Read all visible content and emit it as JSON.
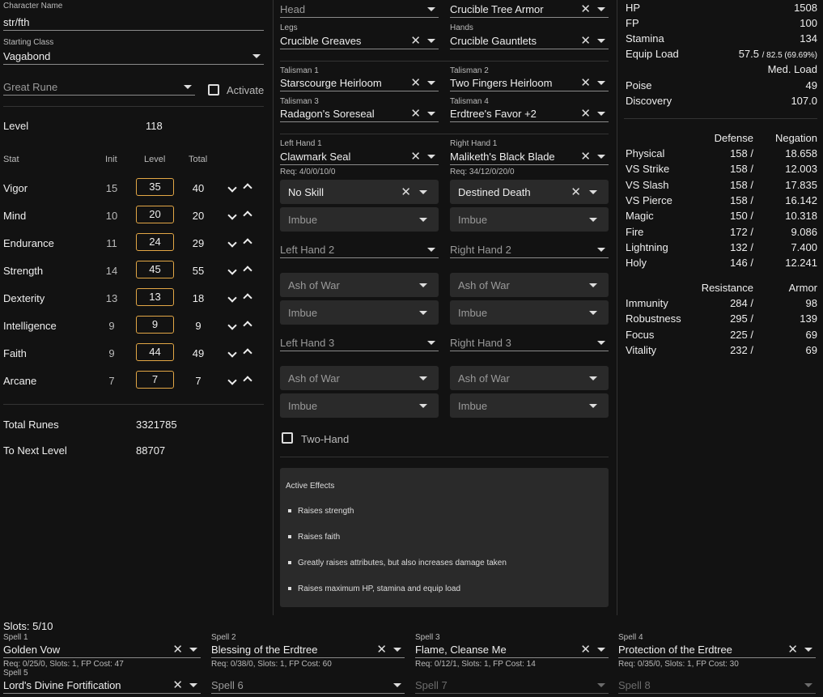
{
  "character": {
    "name_label": "Character Name",
    "name": "str/fth",
    "class_label": "Starting Class",
    "class": "Vagabond",
    "great_rune_placeholder": "Great Rune",
    "activate_label": "Activate"
  },
  "level": {
    "label": "Level",
    "value": "118"
  },
  "stat_headers": {
    "stat": "Stat",
    "init": "Init",
    "level": "Level",
    "total": "Total"
  },
  "stats": [
    {
      "name": "Vigor",
      "init": "15",
      "level": "35",
      "total": "40"
    },
    {
      "name": "Mind",
      "init": "10",
      "level": "20",
      "total": "20"
    },
    {
      "name": "Endurance",
      "init": "11",
      "level": "24",
      "total": "29"
    },
    {
      "name": "Strength",
      "init": "14",
      "level": "45",
      "total": "55"
    },
    {
      "name": "Dexterity",
      "init": "13",
      "level": "13",
      "total": "18"
    },
    {
      "name": "Intelligence",
      "init": "9",
      "level": "9",
      "total": "9"
    },
    {
      "name": "Faith",
      "init": "9",
      "level": "44",
      "total": "49"
    },
    {
      "name": "Arcane",
      "init": "7",
      "level": "7",
      "total": "7"
    }
  ],
  "runes": {
    "total_label": "Total Runes",
    "total": "3321785",
    "next_label": "To Next Level",
    "next": "88707"
  },
  "equipment": {
    "head_placeholder": "Head",
    "chest": "Crucible Tree Armor",
    "legs_label": "Legs",
    "legs": "Crucible Greaves",
    "hands_label": "Hands",
    "hands": "Crucible Gauntlets",
    "t1_label": "Talisman 1",
    "t1": "Starscourge Heirloom",
    "t2_label": "Talisman 2",
    "t2": "Two Fingers Heirloom",
    "t3_label": "Talisman 3",
    "t3": "Radagon's Soreseal",
    "t4_label": "Talisman 4",
    "t4": "Erdtree's Favor +2",
    "lh1_label": "Left Hand 1",
    "lh1": "Clawmark Seal",
    "lh1_req": "Req: 4/0/0/10/0",
    "rh1_label": "Right Hand 1",
    "rh1": "Maliketh's Black Blade",
    "rh1_req": "Req: 34/12/0/20/0",
    "lh1_skill": "No Skill",
    "rh1_skill": "Destined Death",
    "imbue": "Imbue",
    "ash": "Ash of War",
    "lh2": "Left Hand 2",
    "rh2": "Right Hand 2",
    "lh3": "Left Hand 3",
    "rh3": "Right Hand 3",
    "two_hand_label": "Two-Hand"
  },
  "effects": {
    "title": "Active Effects",
    "items": [
      "Raises strength",
      "Raises faith",
      "Greatly raises attributes, but also increases damage taken",
      "Raises maximum HP, stamina and equip load"
    ]
  },
  "stats_right": {
    "hp_label": "HP",
    "hp": "1508",
    "fp_label": "FP",
    "fp": "100",
    "stamina_label": "Stamina",
    "stamina": "134",
    "equip_label": "Equip Load",
    "equip": "57.5",
    "equip_detail": "/ 82.5 (69.69%)",
    "load_class": "Med. Load",
    "poise_label": "Poise",
    "poise": "49",
    "discovery_label": "Discovery",
    "discovery": "107.0"
  },
  "defense": {
    "h1": "Defense",
    "h2": "Negation",
    "rows": [
      {
        "name": "Physical",
        "def": "158 /",
        "neg": "18.658"
      },
      {
        "name": "VS Strike",
        "def": "158 /",
        "neg": "12.003"
      },
      {
        "name": "VS Slash",
        "def": "158 /",
        "neg": "17.835"
      },
      {
        "name": "VS Pierce",
        "def": "158 /",
        "neg": "16.142"
      },
      {
        "name": "Magic",
        "def": "150 /",
        "neg": "10.318"
      },
      {
        "name": "Fire",
        "def": "172 /",
        "neg": "9.086"
      },
      {
        "name": "Lightning",
        "def": "132 /",
        "neg": "7.400"
      },
      {
        "name": "Holy",
        "def": "146 /",
        "neg": "12.241"
      }
    ]
  },
  "resistance": {
    "h1": "Resistance",
    "h2": "Armor",
    "rows": [
      {
        "name": "Immunity",
        "res": "284 /",
        "arm": "98"
      },
      {
        "name": "Robustness",
        "res": "295 /",
        "arm": "139"
      },
      {
        "name": "Focus",
        "res": "225 /",
        "arm": "69"
      },
      {
        "name": "Vitality",
        "res": "232 /",
        "arm": "69"
      }
    ]
  },
  "spells": {
    "slots": "Slots: 5/10",
    "items": [
      {
        "label": "Spell 1",
        "value": "Golden Vow",
        "req": "Req: 0/25/0, Slots: 1, FP Cost: 47"
      },
      {
        "label": "Spell 2",
        "value": "Blessing of the Erdtree",
        "req": "Req: 0/38/0, Slots: 1, FP Cost: 60"
      },
      {
        "label": "Spell 3",
        "value": "Flame, Cleanse Me",
        "req": "Req: 0/12/1, Slots: 1, FP Cost: 14"
      },
      {
        "label": "Spell 4",
        "value": "Protection of the Erdtree",
        "req": "Req: 0/35/0, Slots: 1, FP Cost: 30"
      },
      {
        "label": "Spell 5",
        "value": "Lord's Divine Fortification"
      },
      {
        "value": "Spell 6"
      },
      {
        "value": "Spell 7"
      },
      {
        "value": "Spell 8"
      }
    ]
  }
}
